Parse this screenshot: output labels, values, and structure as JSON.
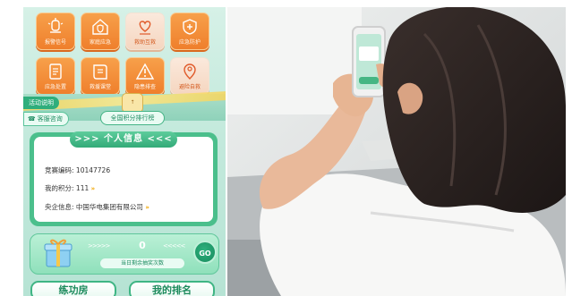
{
  "app": {
    "tiles": [
      {
        "label": "报警信号",
        "icon": "lantern-icon",
        "style": "orange"
      },
      {
        "label": "家庭应急",
        "icon": "house-shield-icon",
        "style": "orange"
      },
      {
        "label": "救助互救",
        "icon": "heart-hand-icon",
        "style": "pale"
      },
      {
        "label": "应急防护",
        "icon": "shield-plus-icon",
        "style": "orange"
      },
      {
        "label": "应急处置",
        "icon": "document-icon",
        "style": "orange"
      },
      {
        "label": "救援课堂",
        "icon": "book-icon",
        "style": "orange"
      },
      {
        "label": "隐患排查",
        "icon": "warning-icon",
        "style": "orange"
      },
      {
        "label": "避险自救",
        "icon": "person-pin-icon",
        "style": "pale"
      }
    ],
    "activity_tag": "活动说明",
    "service_tag": "客服咨询",
    "rank_badge": "↑",
    "rank_button": "全国积分排行榜",
    "info_card": {
      "title": ">>> 个人信息 <<<",
      "rows": [
        {
          "key": "竞赛编码:",
          "value": "10147726",
          "arrow": ""
        },
        {
          "key": "我的积分:",
          "value": "111",
          "arrow": "»"
        },
        {
          "key": "央企信息:",
          "value": "中国华电集团有限公司",
          "arrow": "»"
        }
      ]
    },
    "lottery": {
      "arrows_left": ">>>>>",
      "count": "0",
      "arrows_right": "<<<<<",
      "subtitle": "当日剩余抽奖次数",
      "go": "GO"
    },
    "bottom_buttons": {
      "left": "练功房",
      "right": "我的排名"
    },
    "colors": {
      "accent_green": "#3fb584",
      "tile_orange": "#ef7f2c",
      "panel_bg": "#c3e9dc"
    }
  }
}
